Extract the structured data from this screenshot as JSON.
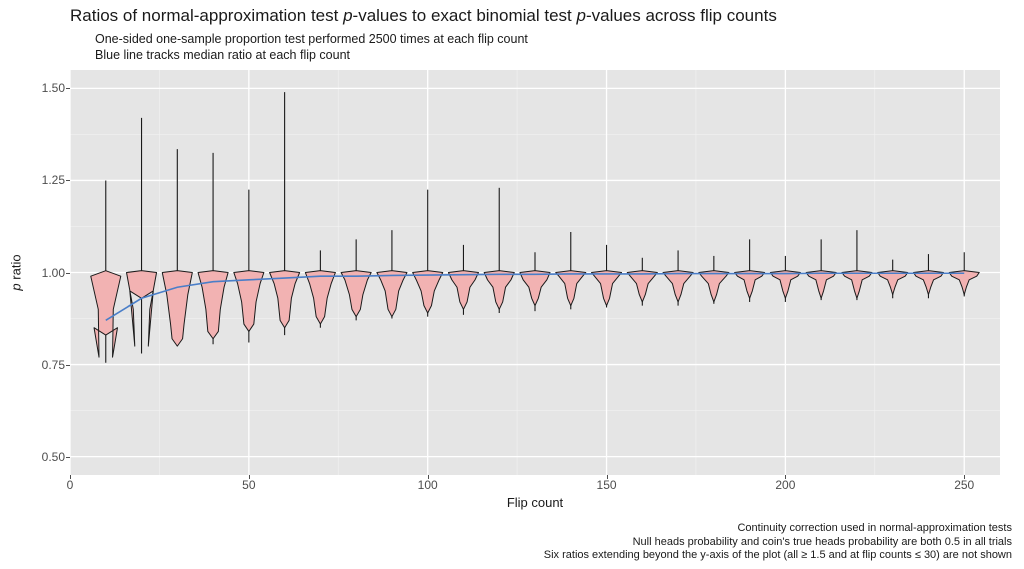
{
  "chart_data": {
    "type": "violin",
    "title_parts": [
      "Ratios of normal-approximation test ",
      "p",
      "-values to exact binomial test ",
      "p",
      "-values across flip counts"
    ],
    "subtitle_line1": "One-sided one-sample proportion test performed 2500 times at each flip count",
    "subtitle_line2": "Blue line tracks median ratio at each flip count",
    "xlabel": "Flip count",
    "ylabel_parts": [
      "p",
      " ratio"
    ],
    "xlim": [
      0,
      260
    ],
    "ylim": [
      0.45,
      1.55
    ],
    "x_ticks": [
      0,
      50,
      100,
      150,
      200,
      250
    ],
    "y_ticks": [
      0.5,
      0.75,
      1.0,
      1.25,
      1.5
    ],
    "y_tick_labels": [
      "0.50",
      "0.75",
      "1.00",
      "1.25",
      "1.50"
    ],
    "panel_bg": "#e5e5e5",
    "grid_major": "#ffffff",
    "grid_minor": "#f2f2f2",
    "violin_fill": "#f2b2b2",
    "violin_stroke": "#1a1a1a",
    "median_line_color": "#4a7ec8",
    "categories": [
      10,
      20,
      30,
      40,
      50,
      60,
      70,
      80,
      90,
      100,
      110,
      120,
      130,
      140,
      150,
      160,
      170,
      180,
      190,
      200,
      210,
      220,
      230,
      240,
      250
    ],
    "median_line": [
      0.87,
      0.93,
      0.96,
      0.975,
      0.98,
      0.985,
      0.99,
      0.99,
      0.992,
      0.993,
      0.994,
      0.995,
      0.995,
      0.996,
      0.996,
      0.996,
      0.997,
      0.997,
      0.997,
      0.997,
      0.998,
      0.998,
      0.998,
      0.998,
      0.998
    ],
    "violins": [
      {
        "x": 10,
        "ymin": 0.755,
        "ymax": 1.25,
        "bulges": [
          {
            "y": 0.99,
            "w": 1.0
          },
          {
            "y": 0.9,
            "w": 0.5
          },
          {
            "y": 0.77,
            "w": 0.45
          },
          {
            "y": 0.85,
            "w": 0.78
          }
        ]
      },
      {
        "x": 20,
        "ymin": 0.78,
        "ymax": 1.42,
        "bulges": [
          {
            "y": 1.0,
            "w": 1.0
          },
          {
            "y": 0.9,
            "w": 0.55
          },
          {
            "y": 0.8,
            "w": 0.45
          },
          {
            "y": 0.95,
            "w": 0.78
          }
        ]
      },
      {
        "x": 30,
        "ymin": 0.8,
        "ymax": 1.335,
        "bulges": [
          {
            "y": 1.0,
            "w": 1.0
          },
          {
            "y": 0.94,
            "w": 0.7
          },
          {
            "y": 0.86,
            "w": 0.45
          },
          {
            "y": 0.82,
            "w": 0.35
          }
        ]
      },
      {
        "x": 40,
        "ymin": 0.805,
        "ymax": 1.325,
        "bulges": [
          {
            "y": 1.0,
            "w": 1.0
          },
          {
            "y": 0.96,
            "w": 0.73
          },
          {
            "y": 0.9,
            "w": 0.48
          },
          {
            "y": 0.84,
            "w": 0.35
          }
        ]
      },
      {
        "x": 50,
        "ymin": 0.81,
        "ymax": 1.225,
        "bulges": [
          {
            "y": 1.0,
            "w": 1.0
          },
          {
            "y": 0.97,
            "w": 0.75
          },
          {
            "y": 0.92,
            "w": 0.48
          },
          {
            "y": 0.86,
            "w": 0.33
          }
        ]
      },
      {
        "x": 60,
        "ymin": 0.83,
        "ymax": 1.49,
        "bulges": [
          {
            "y": 1.0,
            "w": 1.0
          },
          {
            "y": 0.97,
            "w": 0.7
          },
          {
            "y": 0.93,
            "w": 0.45
          },
          {
            "y": 0.87,
            "w": 0.3
          }
        ]
      },
      {
        "x": 70,
        "ymin": 0.85,
        "ymax": 1.06,
        "bulges": [
          {
            "y": 1.0,
            "w": 1.0
          },
          {
            "y": 0.97,
            "w": 0.72
          },
          {
            "y": 0.93,
            "w": 0.45
          },
          {
            "y": 0.88,
            "w": 0.28
          }
        ]
      },
      {
        "x": 80,
        "ymin": 0.87,
        "ymax": 1.09,
        "bulges": [
          {
            "y": 1.0,
            "w": 1.0
          },
          {
            "y": 0.98,
            "w": 0.75
          },
          {
            "y": 0.94,
            "w": 0.45
          },
          {
            "y": 0.9,
            "w": 0.28
          }
        ]
      },
      {
        "x": 90,
        "ymin": 0.875,
        "ymax": 1.115,
        "bulges": [
          {
            "y": 1.0,
            "w": 1.0
          },
          {
            "y": 0.98,
            "w": 0.75
          },
          {
            "y": 0.95,
            "w": 0.45
          },
          {
            "y": 0.9,
            "w": 0.26
          }
        ]
      },
      {
        "x": 100,
        "ymin": 0.88,
        "ymax": 1.225,
        "bulges": [
          {
            "y": 1.0,
            "w": 1.0
          },
          {
            "y": 0.98,
            "w": 0.76
          },
          {
            "y": 0.95,
            "w": 0.44
          },
          {
            "y": 0.91,
            "w": 0.25
          }
        ]
      },
      {
        "x": 110,
        "ymin": 0.885,
        "ymax": 1.075,
        "bulges": [
          {
            "y": 1.0,
            "w": 1.0
          },
          {
            "y": 0.98,
            "w": 0.77
          },
          {
            "y": 0.96,
            "w": 0.43
          },
          {
            "y": 0.92,
            "w": 0.24
          }
        ]
      },
      {
        "x": 120,
        "ymin": 0.89,
        "ymax": 1.23,
        "bulges": [
          {
            "y": 1.0,
            "w": 1.0
          },
          {
            "y": 0.98,
            "w": 0.78
          },
          {
            "y": 0.96,
            "w": 0.42
          },
          {
            "y": 0.92,
            "w": 0.23
          }
        ]
      },
      {
        "x": 130,
        "ymin": 0.895,
        "ymax": 1.055,
        "bulges": [
          {
            "y": 1.0,
            "w": 1.0
          },
          {
            "y": 0.98,
            "w": 0.79
          },
          {
            "y": 0.96,
            "w": 0.41
          },
          {
            "y": 0.93,
            "w": 0.22
          }
        ]
      },
      {
        "x": 140,
        "ymin": 0.9,
        "ymax": 1.11,
        "bulges": [
          {
            "y": 1.0,
            "w": 1.0
          },
          {
            "y": 0.99,
            "w": 0.79
          },
          {
            "y": 0.97,
            "w": 0.4
          },
          {
            "y": 0.93,
            "w": 0.21
          }
        ]
      },
      {
        "x": 150,
        "ymin": 0.905,
        "ymax": 1.075,
        "bulges": [
          {
            "y": 1.0,
            "w": 1.0
          },
          {
            "y": 0.99,
            "w": 0.8
          },
          {
            "y": 0.97,
            "w": 0.4
          },
          {
            "y": 0.93,
            "w": 0.2
          }
        ]
      },
      {
        "x": 160,
        "ymin": 0.91,
        "ymax": 1.04,
        "bulges": [
          {
            "y": 1.0,
            "w": 1.0
          },
          {
            "y": 0.99,
            "w": 0.8
          },
          {
            "y": 0.97,
            "w": 0.39
          },
          {
            "y": 0.94,
            "w": 0.2
          }
        ]
      },
      {
        "x": 170,
        "ymin": 0.91,
        "ymax": 1.06,
        "bulges": [
          {
            "y": 1.0,
            "w": 1.0
          },
          {
            "y": 0.99,
            "w": 0.8
          },
          {
            "y": 0.97,
            "w": 0.38
          },
          {
            "y": 0.94,
            "w": 0.19
          }
        ]
      },
      {
        "x": 180,
        "ymin": 0.915,
        "ymax": 1.045,
        "bulges": [
          {
            "y": 1.0,
            "w": 1.0
          },
          {
            "y": 0.99,
            "w": 0.81
          },
          {
            "y": 0.97,
            "w": 0.37
          },
          {
            "y": 0.94,
            "w": 0.18
          }
        ]
      },
      {
        "x": 190,
        "ymin": 0.92,
        "ymax": 1.09,
        "bulges": [
          {
            "y": 1.0,
            "w": 1.0
          },
          {
            "y": 0.99,
            "w": 0.81
          },
          {
            "y": 0.98,
            "w": 0.37
          },
          {
            "y": 0.95,
            "w": 0.18
          }
        ]
      },
      {
        "x": 200,
        "ymin": 0.92,
        "ymax": 1.045,
        "bulges": [
          {
            "y": 1.0,
            "w": 1.0
          },
          {
            "y": 0.99,
            "w": 0.82
          },
          {
            "y": 0.98,
            "w": 0.36
          },
          {
            "y": 0.95,
            "w": 0.17
          }
        ]
      },
      {
        "x": 210,
        "ymin": 0.925,
        "ymax": 1.09,
        "bulges": [
          {
            "y": 1.0,
            "w": 1.0
          },
          {
            "y": 0.99,
            "w": 0.82
          },
          {
            "y": 0.98,
            "w": 0.35
          },
          {
            "y": 0.95,
            "w": 0.16
          }
        ]
      },
      {
        "x": 220,
        "ymin": 0.925,
        "ymax": 1.115,
        "bulges": [
          {
            "y": 1.0,
            "w": 1.0
          },
          {
            "y": 0.99,
            "w": 0.82
          },
          {
            "y": 0.98,
            "w": 0.35
          },
          {
            "y": 0.95,
            "w": 0.16
          }
        ]
      },
      {
        "x": 230,
        "ymin": 0.93,
        "ymax": 1.035,
        "bulges": [
          {
            "y": 1.0,
            "w": 1.0
          },
          {
            "y": 0.99,
            "w": 0.83
          },
          {
            "y": 0.98,
            "w": 0.34
          },
          {
            "y": 0.96,
            "w": 0.15
          }
        ]
      },
      {
        "x": 240,
        "ymin": 0.93,
        "ymax": 1.05,
        "bulges": [
          {
            "y": 1.0,
            "w": 1.0
          },
          {
            "y": 0.99,
            "w": 0.83
          },
          {
            "y": 0.98,
            "w": 0.34
          },
          {
            "y": 0.96,
            "w": 0.15
          }
        ]
      },
      {
        "x": 250,
        "ymin": 0.935,
        "ymax": 1.055,
        "bulges": [
          {
            "y": 1.0,
            "w": 1.0
          },
          {
            "y": 0.99,
            "w": 0.83
          },
          {
            "y": 0.98,
            "w": 0.33
          },
          {
            "y": 0.96,
            "w": 0.14
          }
        ]
      }
    ],
    "caption_line1": "Continuity correction used in normal-approximation tests",
    "caption_line2": "Null heads probability and coin's true heads probability are both 0.5 in all trials",
    "caption_line3": "Six ratios extending beyond the y-axis of the plot (all ≥ 1.5 and at flip counts ≤ 30) are not shown"
  }
}
